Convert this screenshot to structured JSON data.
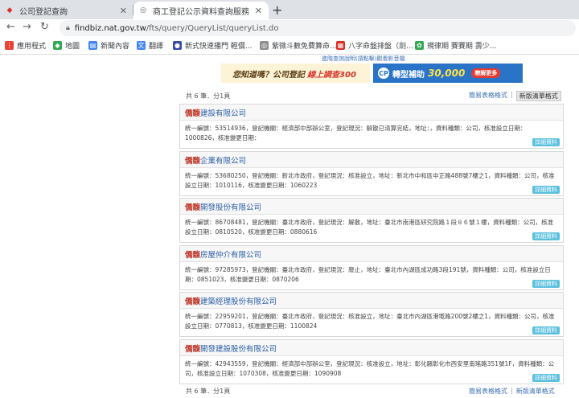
{
  "browser": {
    "tabs": [
      {
        "title": "公司登記查詢",
        "active": false
      },
      {
        "title": "商工登記公示資料查詢服務",
        "active": true
      }
    ],
    "new_tab": "+",
    "url_host": "findbiz.nat.gov.tw",
    "url_path": "/fts/query/QueryList/queryList.do",
    "bookmarks": [
      {
        "label": "應用程式",
        "color": "#ea4335",
        "icon": "apps-grid-icon"
      },
      {
        "label": "地圖",
        "color": "#34a853",
        "icon": "maps-icon"
      },
      {
        "label": "新聞內容",
        "color": "#4285f4",
        "icon": "news-icon"
      },
      {
        "label": "翻譯",
        "color": "#4285f4",
        "icon": "translate-icon"
      },
      {
        "label": "新式快速播門 輕價...",
        "color": "#3949ab",
        "icon": "chat-icon"
      },
      {
        "label": "紫微斗數免費算命...",
        "color": "#8e8e8e",
        "icon": "globe-icon"
      },
      {
        "label": "八字命盤排盤（劍...",
        "color": "#d93025",
        "icon": "calendar-icon"
      },
      {
        "label": "規律期 賽賽期 壽少...",
        "color": "#34a853",
        "icon": "leaf-icon"
      }
    ]
  },
  "banner": {
    "top_link": "進階查詢說明(請點擊)觀看影音檔",
    "ad1_text_a": "您知道嗎？公司登記",
    "ad1_text_b": "線上調查300",
    "ad2_logo": "CP",
    "ad2_text": "轉型補助",
    "ad2_amount": "30,000",
    "ad2_more": "瞭解更多"
  },
  "summary": "共 6 筆．分1頁",
  "view": {
    "table": "簡易表格格式",
    "detail": "新版清單格式"
  },
  "detail_label": "詳細資料",
  "results": [
    {
      "tag": "僑馥",
      "name": "建設有限公司",
      "info": "統一編號：53514936，登記機關：經濟部中部辦公室，登記現況：解散已清算完結，地址：，資料種類：公司，核准設立日期：1000826，核准變更日期："
    },
    {
      "tag": "僑馥",
      "name": "企業有限公司",
      "info": "統一編號：53680250，登記機關：新北市政府，登記現況：核准設立，地址：新北市中和區中正路488號7樓之1，資料種類：公司，核准設立日期：1010116，核准變更日期：1060223"
    },
    {
      "tag": "僑馥",
      "name": "開發股份有限公司",
      "info": "統一編號：86708481，登記機關：臺北市政府，登記現況：解散，地址：臺北市南港區研究院路１段８６號１樓，資料種類：公司，核准設立日期：0810520，核准變更日期：0880616"
    },
    {
      "tag": "僑馥",
      "name": "房屋仲介有限公司",
      "info": "統一編號：97285973，登記機關：臺北市政府，登記現況：廢止，地址：臺北市內湖區成功路3段191號，資料種類：公司，核准設立日期：0851023，核准變更日期：0870206"
    },
    {
      "tag": "僑馥",
      "name": "建築經理股份有限公司",
      "info": "統一編號：22959201，登記機關：臺北市政府，登記現況：核准設立，地址：臺北市內湖區港墘路200號2樓之1，資料種類：公司，核准設立日期：0770813，核准變更日期：1100824"
    },
    {
      "tag": "僑馥",
      "name": "開發建設股份有限公司",
      "info": "統一編號：42943559，登記機關：經濟部中部辦公室，登記現況：核准設立，地址：彰化縣彰化市西安里南瑤路351號1F，資料種類：公司，核准設立日期：1070308，核准變更日期：1090908"
    }
  ]
}
